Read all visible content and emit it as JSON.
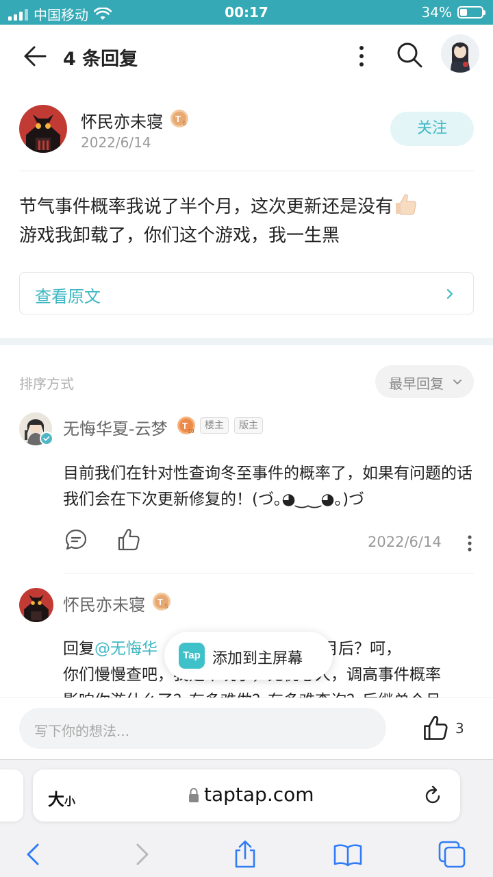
{
  "status_bar": {
    "carrier": "中国移动",
    "time": "00:17",
    "battery": "34%",
    "battery_level": 0.34
  },
  "header": {
    "title": "4 条回复"
  },
  "post": {
    "author": "怀民亦未寝",
    "level_badge": "T5",
    "date": "2022/6/14",
    "follow_label": "关注",
    "content_line1": "节气事件概率我说了半个月，这次更新还是没有",
    "content_line2": "游戏我卸载了，你们这个游戏，我一生黑",
    "view_original": "查看原文"
  },
  "sort": {
    "label": "排序方式",
    "selected": "最早回复"
  },
  "comments": [
    {
      "author": "无悔华夏-云梦",
      "level_badge": "T10",
      "tags": [
        "楼主",
        "版主"
      ],
      "text": "目前我们在针对性查询冬至事件的概率了，如果有问题的话我们会在下次更新修复的！(づ｡◕‿‿◕｡)づ",
      "date": "2022/6/14"
    },
    {
      "author": "怀民亦未寝",
      "level_badge": "T5",
      "reply_prefix": "回复",
      "mention": "@无悔华",
      "text_part1": "是半个月后？呵，",
      "text_line2": "你们慢慢查吧，我是不玩了，无忧心人，调高事件概率",
      "text_line3": "影响你游什么了？有多难做？有多难查询？后继单个月"
    }
  ],
  "toast": {
    "logo": "Tap",
    "text": "添加到主屏幕"
  },
  "comment_bar": {
    "placeholder": "写下你的想法...",
    "like_count": "3"
  },
  "safari": {
    "text_size": "大",
    "text_size_small": "小",
    "url": "taptap.com"
  },
  "colors": {
    "accent": "#3fb8c3",
    "status_bar": "#35a9b5"
  }
}
